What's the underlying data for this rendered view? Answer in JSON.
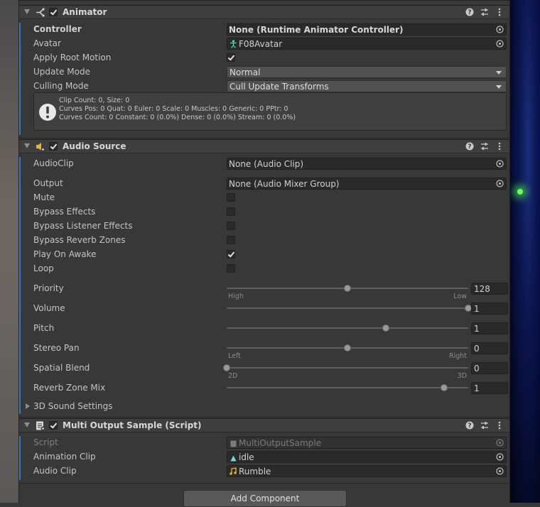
{
  "animator": {
    "title": "Animator",
    "enabled": true,
    "props": {
      "controller": {
        "label": "Controller",
        "value": "None (Runtime Animator Controller)"
      },
      "avatar": {
        "label": "Avatar",
        "value": "F08Avatar"
      },
      "apply_root_motion": {
        "label": "Apply Root Motion",
        "checked": true
      },
      "update_mode": {
        "label": "Update Mode",
        "value": "Normal"
      },
      "culling_mode": {
        "label": "Culling Mode",
        "value": "Cull Update Transforms"
      }
    },
    "info": {
      "line1": "Clip Count: 0, Size: 0",
      "line2": "Curves Pos: 0 Quat: 0 Euler: 0 Scale: 0 Muscles: 0 Generic: 0 PPtr: 0",
      "line3": "Curves Count: 0 Constant: 0 (0.0%) Dense: 0 (0.0%) Stream: 0 (0.0%)"
    }
  },
  "audio_source": {
    "title": "Audio Source",
    "enabled": true,
    "audioclip": {
      "label": "AudioClip",
      "value": "None (Audio Clip)"
    },
    "output": {
      "label": "Output",
      "value": "None (Audio Mixer Group)"
    },
    "toggles": {
      "mute": {
        "label": "Mute",
        "checked": false
      },
      "bypass_effects": {
        "label": "Bypass Effects",
        "checked": false
      },
      "bypass_listener": {
        "label": "Bypass Listener Effects",
        "checked": false
      },
      "bypass_reverb": {
        "label": "Bypass Reverb Zones",
        "checked": false
      },
      "play_on_awake": {
        "label": "Play On Awake",
        "checked": true
      },
      "loop": {
        "label": "Loop",
        "checked": false
      }
    },
    "sliders": {
      "priority": {
        "label": "Priority",
        "value": "128",
        "fraction": 0.5,
        "hint_left": "High",
        "hint_right": "Low"
      },
      "volume": {
        "label": "Volume",
        "value": "1",
        "fraction": 1.0
      },
      "pitch": {
        "label": "Pitch",
        "value": "1",
        "fraction": 0.66
      },
      "stereo_pan": {
        "label": "Stereo Pan",
        "value": "0",
        "fraction": 0.5,
        "hint_left": "Left",
        "hint_right": "Right"
      },
      "spatial_blend": {
        "label": "Spatial Blend",
        "value": "0",
        "fraction": 0.0,
        "hint_left": "2D",
        "hint_right": "3D"
      },
      "reverb_zone_mix": {
        "label": "Reverb Zone Mix",
        "value": "1",
        "fraction": 0.9
      }
    },
    "sound_settings": {
      "label": "3D Sound Settings"
    }
  },
  "multi_output": {
    "title": "Multi Output Sample (Script)",
    "enabled": true,
    "script": {
      "label": "Script",
      "value": "MultiOutputSample"
    },
    "animation_clip": {
      "label": "Animation Clip",
      "value": "idle"
    },
    "audio_clip": {
      "label": "Audio Clip",
      "value": "Rumble"
    }
  },
  "add_component": {
    "label": "Add Component"
  },
  "colors": {
    "accent": "#3a79bb",
    "panel": "#383838",
    "field": "#2a2a2a",
    "header": "#3e3e3e"
  }
}
